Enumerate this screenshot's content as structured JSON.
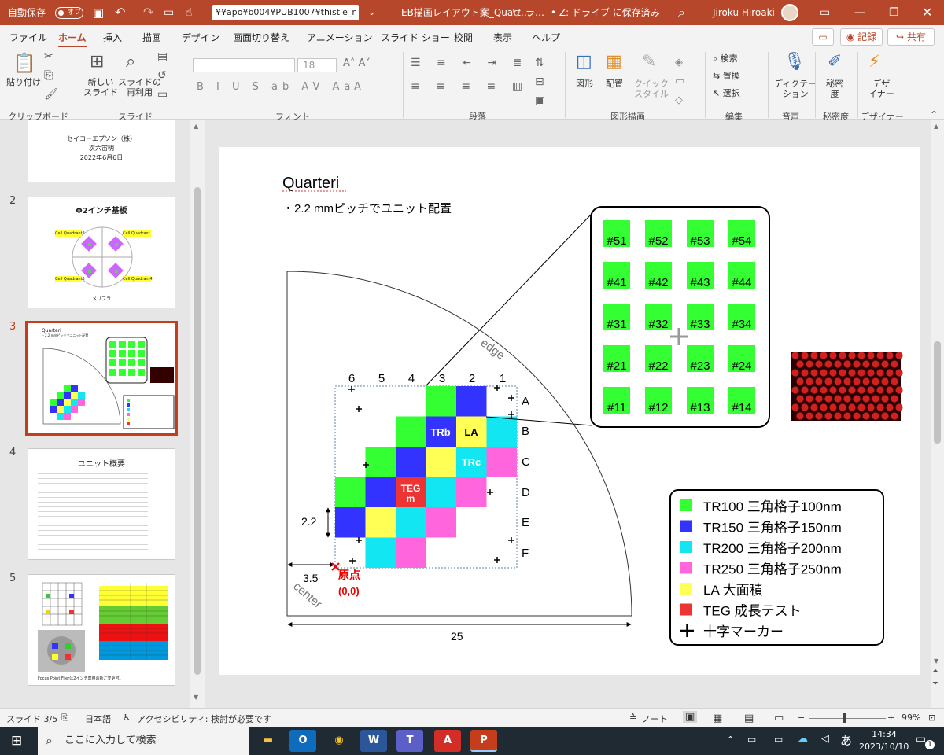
{
  "titlebar": {
    "autosave": "自動保存",
    "toggle": "オフ",
    "path": "¥¥apo¥b004¥PUB1007¥thistle_r",
    "doc": "EB描画レイアウト案_Quart…",
    "label": "ラ…",
    "saved": "• Z: ドライブ に保存済み",
    "user": "Jiroku Hiroaki"
  },
  "menu": {
    "tabs": [
      "ファイル",
      "ホーム",
      "挿入",
      "描画",
      "デザイン",
      "画面切り替え",
      "アニメーション",
      "スライド ショー",
      "校閲",
      "表示",
      "ヘルプ"
    ],
    "record": "記録",
    "share": "共有"
  },
  "ribbon": {
    "paste": "貼り付け",
    "new_slide": "新しい\nスライド",
    "reuse": "スライドの\n再利用",
    "font_size": "18",
    "find": "検索",
    "replace": "置換",
    "select": "選択",
    "shape": "図形",
    "arrange": "配置",
    "quick_style": "クイック\nスタイル",
    "dictate": "ディクテー\nション",
    "sensitivity": "秘密\n度",
    "designer": "デザ\nイナー",
    "groups": [
      "クリップボード",
      "スライド",
      "フォント",
      "段落",
      "図形描画",
      "編集",
      "音声",
      "秘密度",
      "デザイナー"
    ]
  },
  "thumbs": {
    "numbers": [
      "2",
      "3",
      "4",
      "5"
    ],
    "t1": {
      "company": "セイコーエプソン（株）",
      "name": "次六宙明",
      "date": "2022年6月6日"
    },
    "t2": {
      "title": "Φ2インチ基板",
      "cell1": "Cell Quadrant2",
      "cell2": "Cell Quadrant",
      "cell3": "Cell Quadrant3",
      "cell4": "Cell Quadrant4",
      "bottom": "メリブラ"
    },
    "t3": {
      "title": "Quarteri",
      "sub": "・2.2 mmピッチでユニット配置"
    },
    "t4": {
      "title": "ユニット概要"
    },
    "t5": {
      "foot": "Focus Point Filerは2インチ専用の新ご変更可。"
    }
  },
  "slide": {
    "title": "Quarteri",
    "subtitle": "・2.2 mmピッチでユニット配置",
    "cols": [
      "6",
      "5",
      "4",
      "3",
      "2",
      "1"
    ],
    "rows": [
      "A",
      "B",
      "C",
      "D",
      "E",
      "F"
    ],
    "trb": "TRb",
    "la": "LA",
    "trc": "TRc",
    "teg1": "TEG",
    "teg2": "m",
    "edge": "edge",
    "center": "center",
    "origin": "原点",
    "origin_xy": "(0,0)",
    "dim_22": "2.2",
    "dim_35": "3.5",
    "dim_25": "25",
    "units": [
      [
        "#51",
        "#52",
        "#53",
        "#54"
      ],
      [
        "#41",
        "#42",
        "#43",
        "#44"
      ],
      [
        "#31",
        "#32",
        "#33",
        "#34"
      ],
      [
        "#21",
        "#22",
        "#23",
        "#24"
      ],
      [
        "#11",
        "#12",
        "#13",
        "#14"
      ]
    ],
    "legend": [
      {
        "color": "#33ff33",
        "label": "TR100 三角格子100nm"
      },
      {
        "color": "#3333ff",
        "label": "TR150 三角格子150nm"
      },
      {
        "color": "#11e6f2",
        "label": "TR200 三角格子200nm"
      },
      {
        "color": "#ff66dd",
        "label": "TR250 三角格子250nm"
      },
      {
        "color": "#ffff55",
        "label": "LA 大面積"
      },
      {
        "color": "#ee3333",
        "label": "TEG 成長テスト"
      },
      {
        "color": "",
        "label": "十字マーカー"
      }
    ]
  },
  "status": {
    "slide": "スライド 3/5",
    "lang": "日本語",
    "access": "アクセシビリティ: 検討が必要です",
    "notes": "ノート",
    "zoom": "99%"
  },
  "taskbar": {
    "search": "ここに入力して検索",
    "ime": "あ",
    "time": "14:34",
    "date": "2023/10/10",
    "badge": "1"
  }
}
